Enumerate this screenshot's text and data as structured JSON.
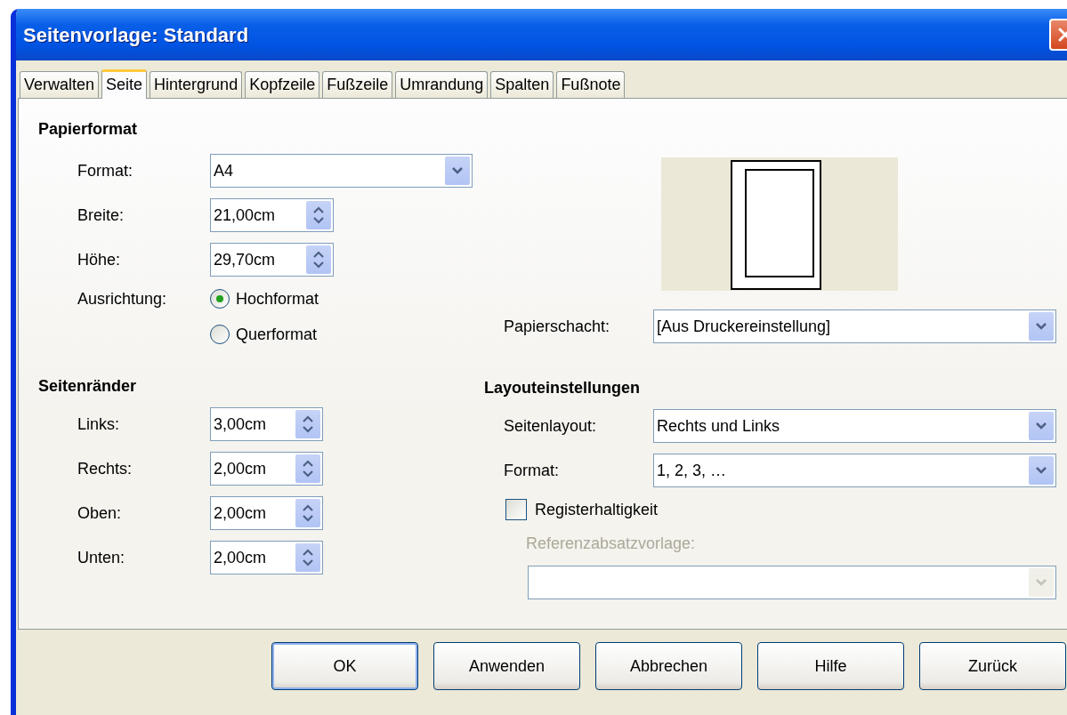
{
  "window": {
    "title": "Seitenvorlage: Standard"
  },
  "tabs": [
    {
      "label": "Verwalten",
      "selected": false
    },
    {
      "label": "Seite",
      "selected": true
    },
    {
      "label": "Hintergrund",
      "selected": false
    },
    {
      "label": "Kopfzeile",
      "selected": false
    },
    {
      "label": "Fußzeile",
      "selected": false
    },
    {
      "label": "Umrandung",
      "selected": false
    },
    {
      "label": "Spalten",
      "selected": false
    },
    {
      "label": "Fußnote",
      "selected": false
    }
  ],
  "paper_format": {
    "heading": "Papierformat",
    "format": {
      "label": "Format:",
      "value": "A4"
    },
    "size": [
      {
        "label": "Breite:",
        "value": "21,00cm"
      },
      {
        "label": "Höhe:",
        "value": "29,70cm"
      }
    ],
    "orientation": {
      "label": "Ausrichtung:",
      "options": [
        {
          "label": "Hochformat",
          "selected": true
        },
        {
          "label": "Querformat",
          "selected": false
        }
      ]
    }
  },
  "paper_tray": {
    "label": "Papierschacht:",
    "value": "[Aus Druckereinstellung]"
  },
  "margins": {
    "heading": "Seitenränder",
    "fields": [
      {
        "label": "Links:",
        "value": "3,00cm"
      },
      {
        "label": "Rechts:",
        "value": "2,00cm"
      },
      {
        "label": "Oben:",
        "value": "2,00cm"
      },
      {
        "label": "Unten:",
        "value": "2,00cm"
      }
    ]
  },
  "layout": {
    "heading": "Layouteinstellungen",
    "page_layout": {
      "label": "Seitenlayout:",
      "value": "Rechts und Links"
    },
    "numbering": {
      "label": "Format:",
      "value": "1, 2, 3, …"
    },
    "register_true": {
      "label": "Registerhaltigkeit",
      "checked": false
    },
    "reference_style": {
      "label": "Referenzabsatzvorlage:",
      "disabled": true
    }
  },
  "buttons": [
    {
      "label": "OK",
      "default": true
    },
    {
      "label": "Anwenden",
      "default": false
    },
    {
      "label": "Abbrechen",
      "default": false
    },
    {
      "label": "Hilfe",
      "default": false
    },
    {
      "label": "Zurück",
      "default": false
    }
  ]
}
